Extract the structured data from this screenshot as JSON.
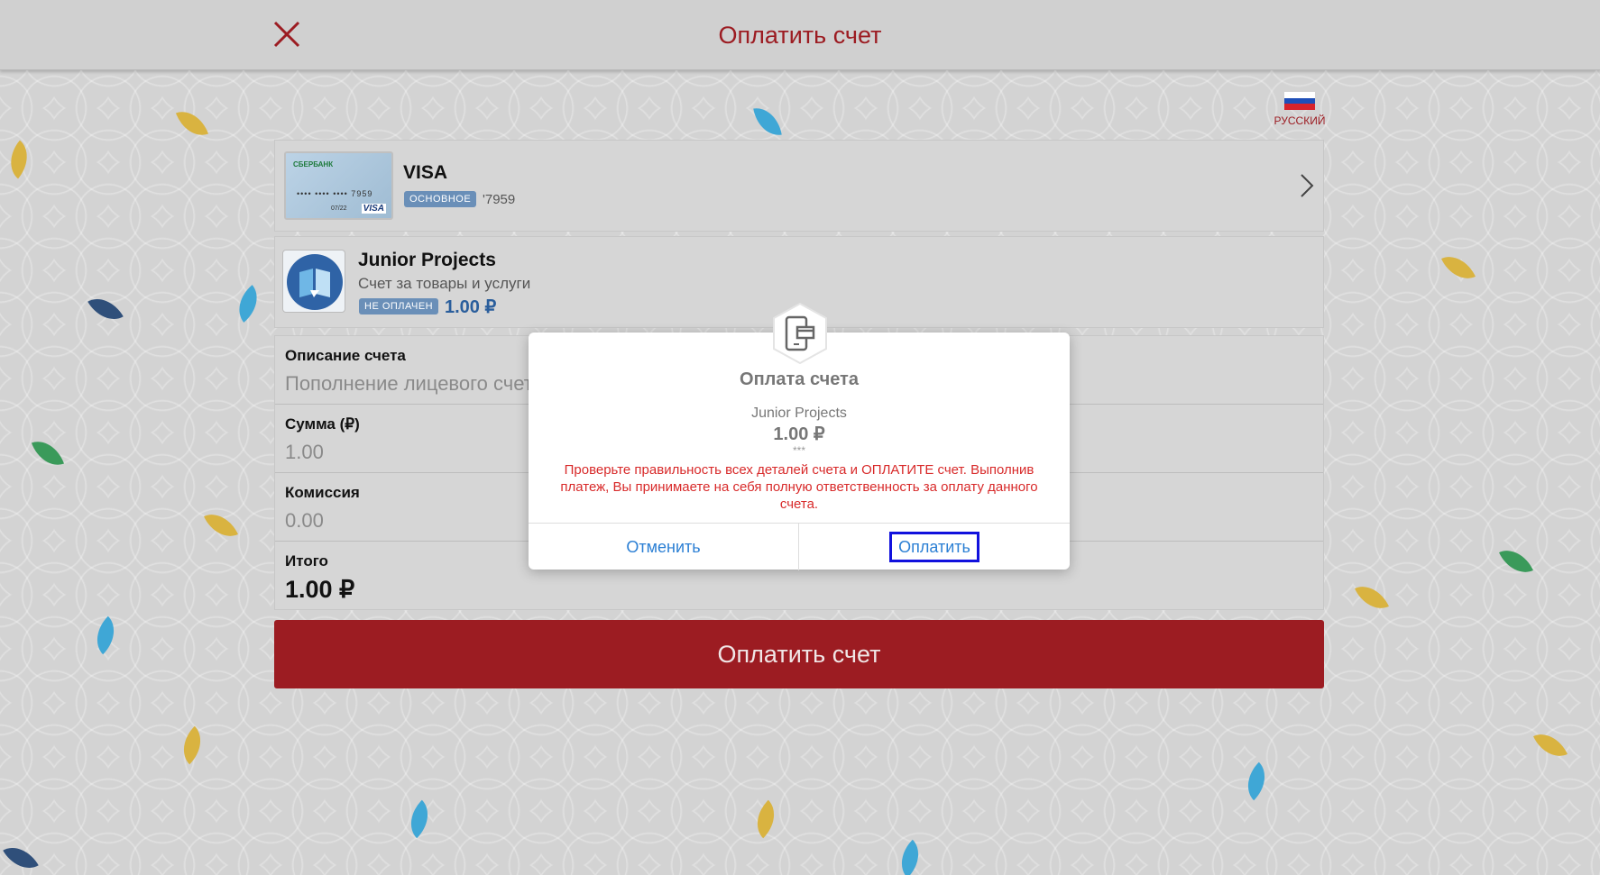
{
  "header": {
    "title": "Оплатить счет",
    "close_icon": "close-icon"
  },
  "language": {
    "label": "РУССКИЙ",
    "flag_colors": [
      "#ffffff",
      "#1f4fb8",
      "#d8232a"
    ]
  },
  "card": {
    "bank_name": "СБЕРБАНК",
    "thumb_number": "•••• •••• •••• 7959",
    "thumb_expiry": "07/22",
    "thumb_brand": "VISA",
    "title": "VISA",
    "badge": "ОСНОВНОЕ",
    "suffix": "'7959"
  },
  "merchant": {
    "name": "Junior Projects",
    "description": "Счет за товары и услуги",
    "status_badge": "НЕ ОПЛАЧЕН",
    "amount": "1.00 ₽"
  },
  "form": {
    "description_label": "Описание счета",
    "description_value": "Пополнение лицевого счета",
    "sum_label": "Сумма (₽)",
    "sum_value": "1.00",
    "commission_label": "Комиссия",
    "commission_value": "0.00",
    "total_label": "Итого",
    "total_value": "1.00 ₽"
  },
  "pay_button": "Оплатить счет",
  "modal": {
    "title": "Оплата счета",
    "merchant": "Junior Projects",
    "amount": "1.00 ₽",
    "masked": "***",
    "warning": "Проверьте правильность всех деталей счета и ОПЛАТИТЕ счет. Выполнив платеж, Вы принимаете на себя полную ответственность за оплату данного счета.",
    "cancel": "Отменить",
    "confirm": "Оплатить"
  },
  "colors": {
    "brand": "#9c1c22",
    "link": "#2b7fd4",
    "warning": "#d82a2a",
    "badge": "#6a8fb8"
  }
}
